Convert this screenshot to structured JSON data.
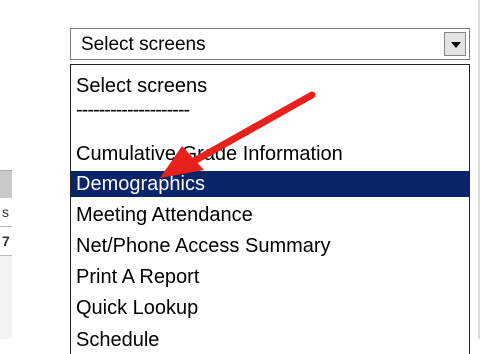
{
  "select": {
    "value": "Select screens"
  },
  "dropdown": {
    "options": [
      "Select screens",
      "--------------------",
      "Cumulative Grade Information",
      "Demographics",
      "Meeting Attendance",
      "Net/Phone Access Summary",
      "Print A Report",
      "Quick Lookup",
      "Schedule"
    ],
    "selected_index": 3,
    "highlight_color": "#0a246a"
  },
  "left_panel": {
    "cells": [
      "s",
      "7"
    ]
  },
  "annotation": {
    "color": "#e8211c",
    "icon": "red-arrow-icon"
  }
}
